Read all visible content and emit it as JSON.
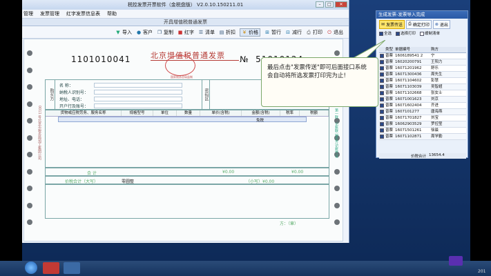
{
  "window": {
    "title": "税控发票开票软件（金税盘版） V2.0.10.150211.01",
    "menu": [
      "管理",
      "发票管理",
      "红字发票信息表",
      "帮助"
    ],
    "doc_title": "开具增值税普通发票",
    "toolbar": [
      "导入",
      "客户",
      "复制",
      "红字",
      "清单",
      "折扣",
      "价格",
      "暂行",
      "减行",
      "打印",
      "退出"
    ]
  },
  "invoice": {
    "code": "1101010041",
    "title": "北京增值税普通发票",
    "number_prefix": "№",
    "number": "51010124",
    "seal_text": "国家税务总局监制",
    "buyer_side": "购买方",
    "code_side": "密码区",
    "buyer_fields": [
      "名  称：",
      "纳税人识别号：",
      "地址、电话：",
      "开户行及账号："
    ],
    "headers": [
      "货物或应税劳务、服务名称",
      "规格型号",
      "单位",
      "数量",
      "单价(含税)",
      "金额(含税)",
      "税率",
      "税额"
    ],
    "row_tax": "免税",
    "total_label": "合    计",
    "total_amount": "¥0.00",
    "total_tax": "¥0.00",
    "capital_label": "价税合计（大写）",
    "capital_value": "零圆整",
    "capital_small": "（小写）¥0.00",
    "payee": "方：（章）",
    "side_left": "0011 号北京市税务局加工集团公司",
    "side_right": "第一联：记账联 销售方记账凭证"
  },
  "callout": {
    "text": "最后点击\"发票传送\"即可后面接口系统会自动将所选发票打印完为止!"
  },
  "dialog": {
    "title": "生成发票-发票导入完成",
    "buttons": [
      "发票传送",
      "确定打印",
      "退出"
    ],
    "options": [
      "全选",
      "选择打印",
      "缓制清单"
    ],
    "columns": [
      "",
      "类型",
      "单据编号",
      "购方"
    ],
    "rows": [
      [
        "普票",
        "1606189541 2",
        "宁"
      ],
      [
        "普票",
        "16020200791",
        "王阳力"
      ],
      [
        "普票",
        "16071201962",
        "舒乐"
      ],
      [
        "普票",
        "16071300436",
        "周先生"
      ],
      [
        "普票",
        "16071104602",
        "彭慧"
      ],
      [
        "普票",
        "16071103039",
        "吴智超"
      ],
      [
        "普票",
        "16071102668",
        "张女士"
      ],
      [
        "普票",
        "16071001623",
        "刘京"
      ],
      [
        "普票",
        "16071602404",
        "齐进"
      ],
      [
        "普票",
        "1607101277",
        "唐海燕"
      ],
      [
        "普票",
        "16071701827",
        "刘宝"
      ],
      [
        "普票",
        "16062903529",
        "罗控莹"
      ],
      [
        "普票",
        "16071501261",
        "徐晨"
      ],
      [
        "普票",
        "16071102871",
        "周学勤"
      ]
    ],
    "sum_label": "价税合计",
    "sum_value": "13654.4"
  },
  "taskbar": {
    "clock": "201"
  }
}
